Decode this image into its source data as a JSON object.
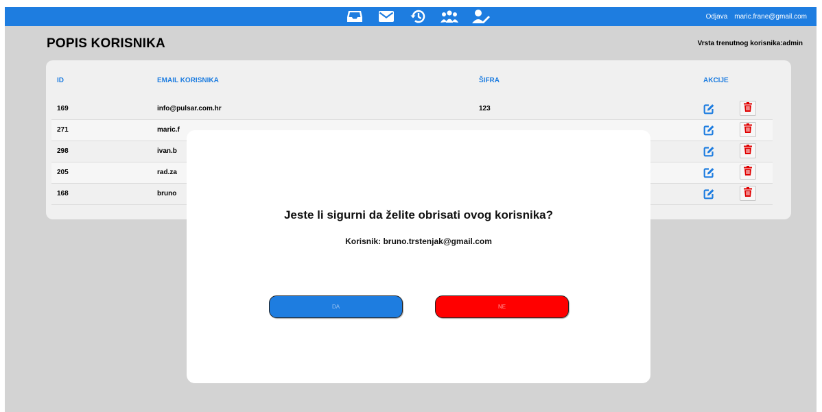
{
  "nav": {
    "icons": [
      "inbox-icon",
      "mail-icon",
      "history-icon",
      "users-icon",
      "user-edit-icon"
    ],
    "logout_label": "Odjava",
    "user_email": "maric.frane@gmail.com"
  },
  "page": {
    "title": "POPIS KORISNIKA",
    "user_type": "Vrsta trenutnog korisnika:admin"
  },
  "table": {
    "headers": {
      "id": "ID",
      "email": "EMAIL KORISNIKA",
      "password": "ŠIFRA",
      "actions": "AKCIJE"
    },
    "rows": [
      {
        "id": "169",
        "email": "info@pulsar.com.hr",
        "password": "123"
      },
      {
        "id": "271",
        "email": "maric.f",
        "password": ""
      },
      {
        "id": "298",
        "email": "ivan.b",
        "password": ""
      },
      {
        "id": "205",
        "email": "rad.za",
        "password": ""
      },
      {
        "id": "168",
        "email": "bruno",
        "password": ""
      }
    ]
  },
  "modal": {
    "title": "Jeste li sigurni da želite obrisati ovog korisnika?",
    "subtitle": "Korisnik: bruno.trstenjak@gmail.com",
    "yes_label": "DA",
    "no_label": "NE"
  },
  "colors": {
    "primary": "#1e7de0",
    "danger": "#ff0000",
    "background": "#d3d3d3"
  }
}
